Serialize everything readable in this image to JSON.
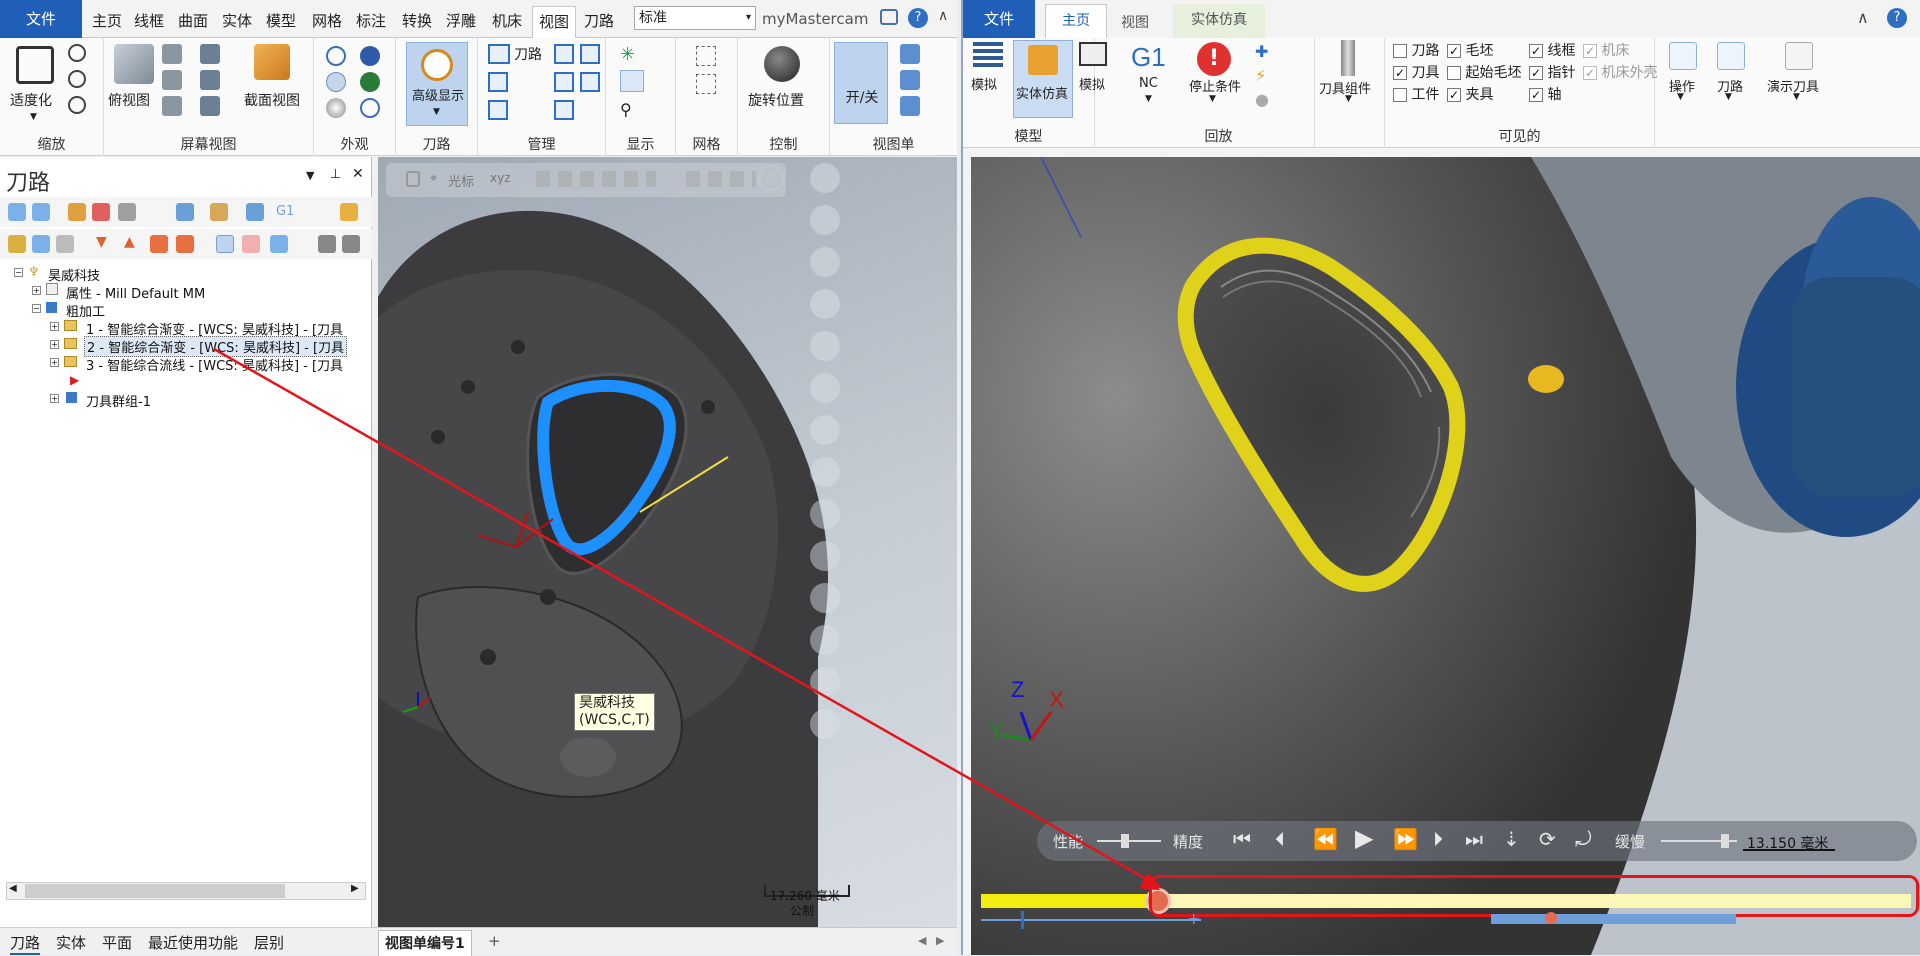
{
  "left": {
    "file_label": "文件",
    "tabs": [
      "主页",
      "线框",
      "曲面",
      "实体",
      "模型",
      "网格",
      "标注",
      "转换",
      "浮雕",
      "机床",
      "视图",
      "刀路"
    ],
    "selected_tab": "视图",
    "combo_value": "标准",
    "app_name": "myMastercam",
    "groups": {
      "zoom": "缩放",
      "fit": "适度化",
      "screen_view": "屏幕视图",
      "top_view": "俯视图",
      "section_view": "截面视图",
      "appearance": "外观",
      "advanced_display": "高级显示",
      "toolpath": "刀路",
      "toolpath_btn": "刀路",
      "manage": "管理",
      "display": "显示",
      "grid": "网格",
      "rotate_pos": "旋转位置",
      "control": "控制",
      "onoff": "开/关",
      "viewsheet": "视图单"
    },
    "panel": {
      "title": "刀路",
      "cursor_label": "光标",
      "tree": {
        "root": "昊威科技",
        "props": "属性 - Mill Default MM",
        "machining": "粗加工",
        "op1": "1 - 智能综合渐变 - [WCS: 昊威科技] - [刀具",
        "op2": "2 - 智能综合渐变 - [WCS: 昊威科技] - [刀具",
        "op3": "3 - 智能综合流线 - [WCS: 昊威科技] - [刀具",
        "toolgroup": "刀具群组-1"
      },
      "bottom_tabs": [
        "刀路",
        "实体",
        "平面",
        "最近使用功能",
        "层别"
      ]
    },
    "viewport": {
      "wcs_label_1": "昊威科技",
      "wcs_label_2": "(WCS,C,T)",
      "scale_value": "17.260 毫米",
      "scale_unit": "公制",
      "viewsheet_tab": "视图单编号1",
      "add_tab": "+"
    }
  },
  "right": {
    "file_label": "文件",
    "tabs": [
      "主页",
      "视图",
      "实体仿真"
    ],
    "selected_tab": "主页",
    "model_group": {
      "label": "模型",
      "btn1": "模拟",
      "btn2": "实体仿真",
      "btn3": "模拟"
    },
    "playback_group": {
      "label": "回放",
      "g1": "G1",
      "nc": "NC",
      "stop": "停止条件",
      "tool_assembly": "刀具组件"
    },
    "visible_group": {
      "label": "可见的",
      "items": [
        {
          "label": "刀路",
          "checked": false,
          "enabled": true
        },
        {
          "label": "毛坯",
          "checked": true,
          "enabled": true
        },
        {
          "label": "线框",
          "checked": true,
          "enabled": true
        },
        {
          "label": "机床",
          "checked": true,
          "enabled": false
        },
        {
          "label": "刀具",
          "checked": true,
          "enabled": true
        },
        {
          "label": "起始毛坯",
          "checked": false,
          "enabled": true
        },
        {
          "label": "指针",
          "checked": true,
          "enabled": true
        },
        {
          "label": "机床外壳",
          "checked": true,
          "enabled": false
        },
        {
          "label": "工件",
          "checked": false,
          "enabled": true
        },
        {
          "label": "夹具",
          "checked": true,
          "enabled": true
        },
        {
          "label": "轴",
          "checked": true,
          "enabled": true
        }
      ]
    },
    "right_btns": {
      "operation": "操作",
      "toolpath": "刀路",
      "demo_tool": "演示刀具"
    },
    "controls": {
      "performance": "性能",
      "precision": "精度",
      "slow": "缓慢",
      "scale": "13.150 毫米",
      "progress": 0.19
    }
  },
  "colors": {
    "accent": "#1f5fb8",
    "highlight_blue": "#1e8fff",
    "progress_yellow": "#f3ec11",
    "annotation_red": "#e4141b"
  }
}
